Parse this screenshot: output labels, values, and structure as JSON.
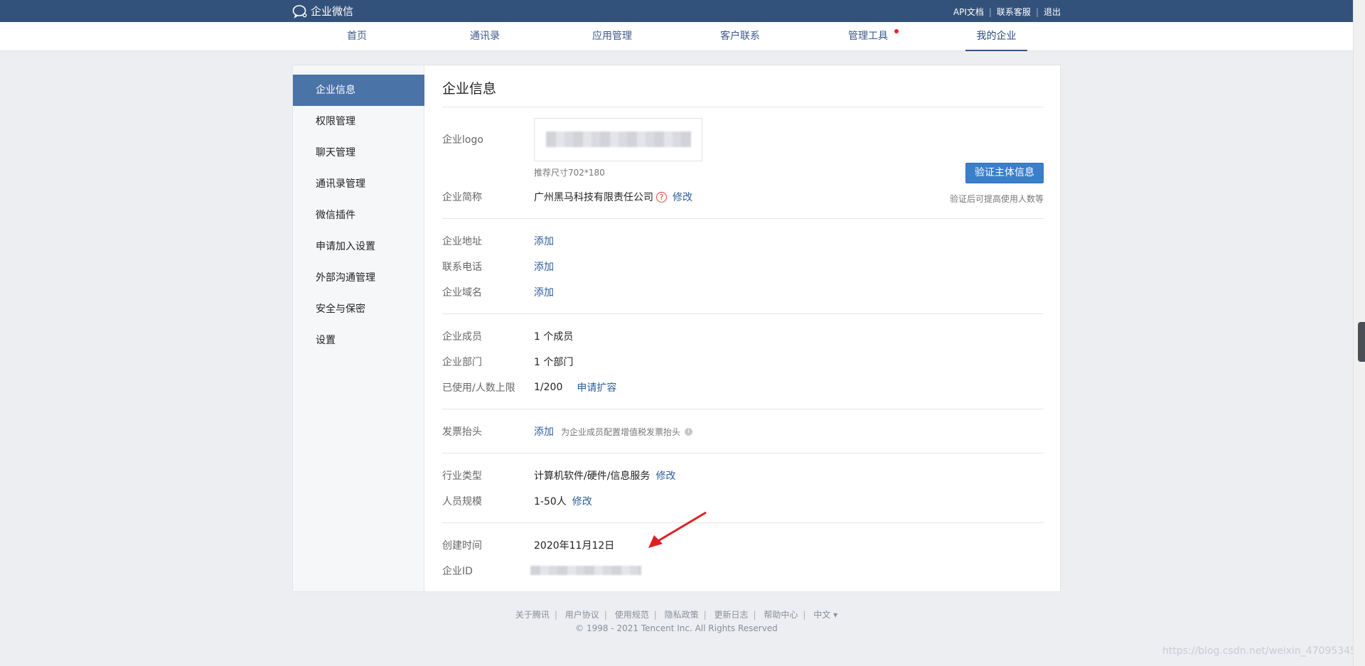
{
  "brand": {
    "name": "企业微信"
  },
  "toplinks": [
    {
      "label": "API文档"
    },
    {
      "label": "联系客服"
    },
    {
      "label": "退出"
    }
  ],
  "nav": [
    {
      "label": "首页"
    },
    {
      "label": "通讯录"
    },
    {
      "label": "应用管理"
    },
    {
      "label": "客户联系"
    },
    {
      "label": "管理工具"
    },
    {
      "label": "我的企业"
    }
  ],
  "sidebar": [
    {
      "label": "企业信息"
    },
    {
      "label": "权限管理"
    },
    {
      "label": "聊天管理"
    },
    {
      "label": "通讯录管理"
    },
    {
      "label": "微信插件"
    },
    {
      "label": "申请加入设置"
    },
    {
      "label": "外部沟通管理"
    },
    {
      "label": "安全与保密"
    },
    {
      "label": "设置"
    }
  ],
  "content": {
    "title": "企业信息",
    "logo_label": "企业logo",
    "logo_hint": "推荐尺寸702*180",
    "verify_button": "验证主体信息",
    "verify_hint": "验证后可提高使用人数等",
    "short_name_label": "企业简称",
    "short_name_value": "广州黑马科技有限责任公司",
    "modify": "修改",
    "address_label": "企业地址",
    "phone_label": "联系电话",
    "domain_label": "企业域名",
    "add": "添加",
    "members_label": "企业成员",
    "members_value": "1 个成员",
    "departments_label": "企业部门",
    "departments_value": "1 个部门",
    "limit_label": "已使用/人数上限",
    "limit_value": "1/200",
    "expand": "申请扩容",
    "invoice_label": "发票抬头",
    "invoice_hint": "为企业成员配置增值税发票抬头",
    "industry_label": "行业类型",
    "industry_value": "计算机软件/硬件/信息服务",
    "scale_label": "人员规模",
    "scale_value": "1-50人",
    "created_label": "创建时间",
    "created_value": "2020年11月12日",
    "corp_id_label": "企业ID"
  },
  "footer": {
    "links": [
      "关于腾讯",
      "用户协议",
      "使用规范",
      "隐私政策",
      "更新日志",
      "帮助中心",
      "中文 ▾"
    ],
    "copyright": "© 1998 - 2021 Tencent Inc. All Rights Reserved"
  },
  "watermark": "https://blog.csdn.net/weixin_47095345",
  "colors": {
    "topbar": "#33527b",
    "accent": "#4a73a8",
    "button": "#3a7fc9",
    "link": "#2d5d9b",
    "arrow": "#e02020"
  }
}
